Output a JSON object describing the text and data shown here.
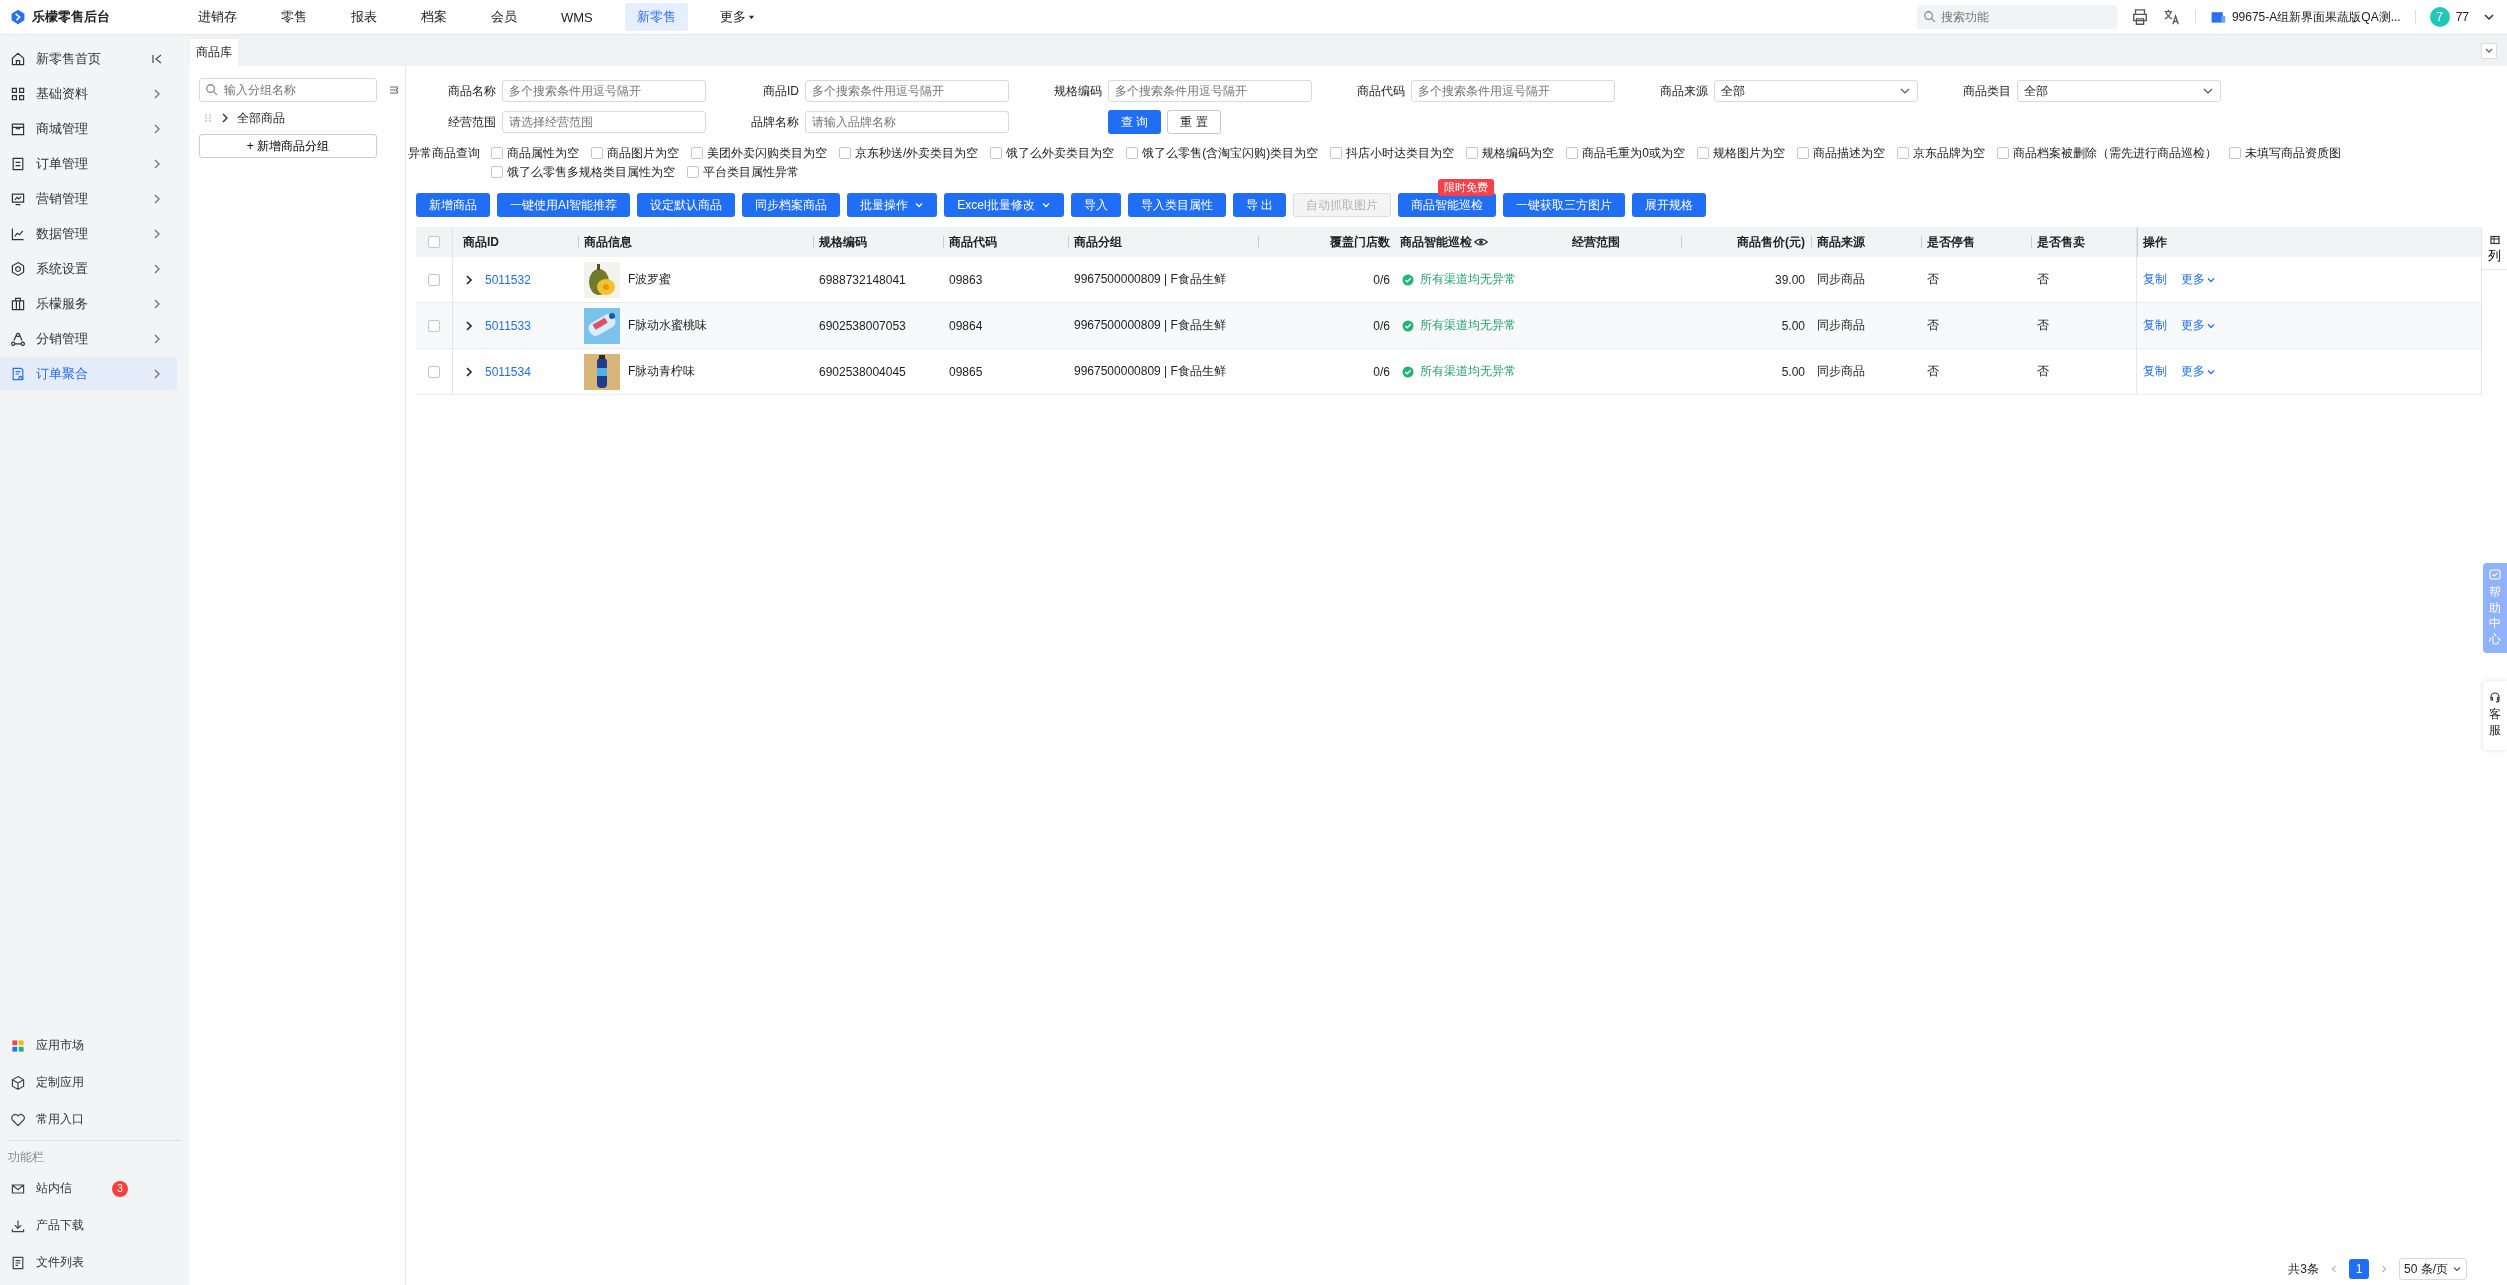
{
  "app": {
    "title": "乐檬零售后台"
  },
  "nav": [
    {
      "label": "进销存",
      "selected": false,
      "kind": "link"
    },
    {
      "label": "零售",
      "selected": false,
      "kind": "link"
    },
    {
      "label": "报表",
      "selected": false,
      "kind": "link"
    },
    {
      "label": "档案",
      "selected": false,
      "kind": "link"
    },
    {
      "label": "会员",
      "selected": false,
      "kind": "link"
    },
    {
      "label": "WMS",
      "selected": false,
      "kind": "link"
    },
    {
      "label": "新零售",
      "selected": true,
      "kind": "link"
    },
    {
      "label": "更多",
      "selected": false,
      "kind": "dropdown"
    }
  ],
  "header": {
    "search_placeholder": "搜索功能",
    "account": "99675-A组新界面果蔬版QA测...",
    "avatar": "7",
    "user": "77"
  },
  "sidebar": {
    "items": [
      {
        "label": "新零售首页",
        "selected": false
      },
      {
        "label": "基础资料",
        "selected": false
      },
      {
        "label": "商城管理",
        "selected": false
      },
      {
        "label": "订单管理",
        "selected": false
      },
      {
        "label": "营销管理",
        "selected": false
      },
      {
        "label": "数据管理",
        "selected": false
      },
      {
        "label": "系统设置",
        "selected": false
      },
      {
        "label": "乐檬服务",
        "selected": false
      },
      {
        "label": "分销管理",
        "selected": false
      },
      {
        "label": "订单聚合",
        "selected": true
      }
    ],
    "bottom_items": [
      {
        "label": "应用市场"
      },
      {
        "label": "定制应用"
      },
      {
        "label": "常用入口"
      }
    ],
    "section_label": "功能栏",
    "func_items": [
      {
        "label": "站内信",
        "badge": "3"
      },
      {
        "label": "产品下载"
      },
      {
        "label": "文件列表"
      }
    ]
  },
  "tabs": [
    {
      "label": "商品库",
      "selected": true
    }
  ],
  "group_panel": {
    "search_placeholder": "输入分组名称",
    "tree": [
      {
        "label": "全部商品",
        "expanded": false
      }
    ],
    "add_button": "+ 新增商品分组"
  },
  "filters": {
    "fields": [
      {
        "label": "商品名称",
        "kind": "input",
        "placeholder": "多个搜索条件用逗号隔开"
      },
      {
        "label": "商品ID",
        "kind": "input",
        "placeholder": "多个搜索条件用逗号隔开"
      },
      {
        "label": "规格编码",
        "kind": "input",
        "placeholder": "多个搜索条件用逗号隔开"
      },
      {
        "label": "商品代码",
        "kind": "input",
        "placeholder": "多个搜索条件用逗号隔开"
      },
      {
        "label": "商品来源",
        "kind": "select",
        "value": "全部"
      },
      {
        "label": "商品类目",
        "kind": "select",
        "value": "全部"
      },
      {
        "label": "经营范围",
        "kind": "input",
        "placeholder": "请选择经营范围"
      },
      {
        "label": "品牌名称",
        "kind": "input",
        "placeholder": "请输入品牌名称"
      }
    ],
    "query_button": "查 询",
    "reset_button": "重 置"
  },
  "abnormal": {
    "label": "异常商品查询",
    "options": [
      {
        "label": "商品属性为空",
        "checked": false
      },
      {
        "label": "商品图片为空",
        "checked": false
      },
      {
        "label": "美团外卖闪购类目为空",
        "checked": false
      },
      {
        "label": "京东秒送/外卖类目为空",
        "checked": false
      },
      {
        "label": "饿了么外卖类目为空",
        "checked": false
      },
      {
        "label": "饿了么零售(含淘宝闪购)类目为空",
        "checked": false
      },
      {
        "label": "抖店小时达类目为空",
        "checked": false
      },
      {
        "label": "规格编码为空",
        "checked": false
      },
      {
        "label": "商品毛重为0或为空",
        "checked": false
      },
      {
        "label": "规格图片为空",
        "checked": false
      },
      {
        "label": "商品描述为空",
        "checked": false
      },
      {
        "label": "京东品牌为空",
        "checked": false
      },
      {
        "label": "商品档案被删除（需先进行商品巡检）",
        "checked": false
      },
      {
        "label": "未填写商品资质图",
        "checked": false
      },
      {
        "label": "饿了么零售多规格类目属性为空",
        "checked": false
      },
      {
        "label": "平台类目属性异常",
        "checked": false
      }
    ]
  },
  "actions": [
    {
      "label": "新增商品",
      "kind": "button",
      "disabled": false
    },
    {
      "label": "一键使用AI智能推荐",
      "kind": "button",
      "disabled": false
    },
    {
      "label": "设定默认商品",
      "kind": "button",
      "disabled": false
    },
    {
      "label": "同步档案商品",
      "kind": "button",
      "disabled": false
    },
    {
      "label": "批量操作",
      "kind": "dropdown",
      "disabled": false
    },
    {
      "label": "Excel批量修改",
      "kind": "dropdown",
      "disabled": false
    },
    {
      "label": "导入",
      "kind": "button",
      "disabled": false
    },
    {
      "label": "导入类目属性",
      "kind": "button",
      "disabled": false
    },
    {
      "label": "导 出",
      "kind": "button",
      "disabled": false
    },
    {
      "label": "自动抓取图片",
      "kind": "button",
      "disabled": true
    },
    {
      "label": "商品智能巡检",
      "kind": "button",
      "disabled": false,
      "badge": "限时免费"
    },
    {
      "label": "一键获取三方图片",
      "kind": "button",
      "disabled": false
    },
    {
      "label": "展开规格",
      "kind": "button",
      "disabled": false
    }
  ],
  "table": {
    "header_checked": false,
    "columns": [
      "商品ID",
      "商品信息",
      "规格编码",
      "商品代码",
      "商品分组",
      "覆盖门店数",
      "商品智能巡检",
      "经营范围",
      "商品售价(元)",
      "商品来源",
      "是否停售",
      "是否售卖",
      "操作"
    ],
    "column_settings": "列",
    "rows": [
      {
        "checked": false,
        "expanded": false,
        "id": "5011532",
        "name": "F波罗蜜",
        "spec_code": "6988732148041",
        "code": "09863",
        "group": "9967500000809 | F食品生鲜",
        "stores": "0/6",
        "inspection": "所有渠道均无异常",
        "price": "39.00",
        "source": "同步商品",
        "stopped": "否",
        "on_sale": "否",
        "actions": [
          "复制",
          "更多"
        ]
      },
      {
        "checked": false,
        "expanded": false,
        "id": "5011533",
        "name": "F脉动水蜜桃味",
        "spec_code": "6902538007053",
        "code": "09864",
        "group": "9967500000809 | F食品生鲜",
        "stores": "0/6",
        "inspection": "所有渠道均无异常",
        "price": "5.00",
        "source": "同步商品",
        "stopped": "否",
        "on_sale": "否",
        "actions": [
          "复制",
          "更多"
        ]
      },
      {
        "checked": false,
        "expanded": false,
        "id": "5011534",
        "name": "F脉动青柠味",
        "spec_code": "6902538004045",
        "code": "09865",
        "group": "9967500000809 | F食品生鲜",
        "stores": "0/6",
        "inspection": "所有渠道均无异常",
        "price": "5.00",
        "source": "同步商品",
        "stopped": "否",
        "on_sale": "否",
        "actions": [
          "复制",
          "更多"
        ]
      }
    ]
  },
  "pagination": {
    "total": "共3条",
    "pages": [
      {
        "label": "1",
        "selected": true
      }
    ],
    "page_size": "50 条/页"
  },
  "float": {
    "help": "帮助中心",
    "service": "客服"
  }
}
